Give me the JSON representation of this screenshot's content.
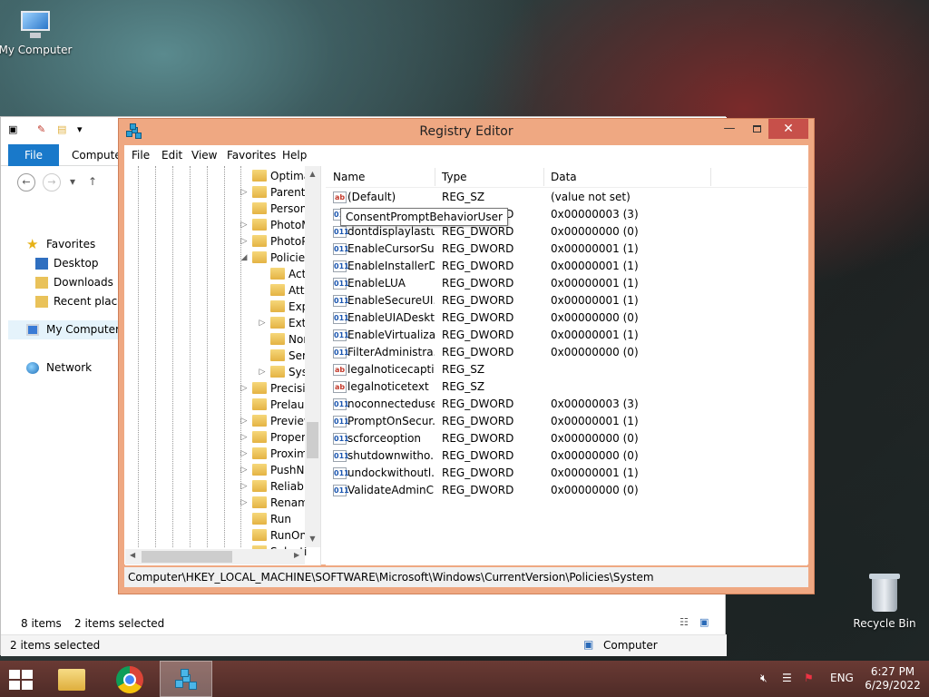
{
  "desktop": {
    "icons": [
      {
        "label": "My Computer",
        "icon": "computer-icon"
      },
      {
        "label": "Recycle Bin",
        "icon": "recycle-bin-icon"
      }
    ]
  },
  "explorer": {
    "tabs": {
      "file": "File",
      "computer": "Computer"
    },
    "nav": {
      "favorites": "Favorites",
      "desktop": "Desktop",
      "downloads": "Downloads",
      "recent_places": "Recent places",
      "my_computer": "My Computer",
      "network": "Network"
    },
    "status": {
      "items": "8 items",
      "selected": "2 items selected",
      "bottom_selected": "2 items selected",
      "location": "Computer"
    }
  },
  "regedit": {
    "title": "Registry Editor",
    "menu": [
      "File",
      "Edit",
      "View",
      "Favorites",
      "Help"
    ],
    "tree": [
      {
        "label": "Optima",
        "indent": 0,
        "expander": ""
      },
      {
        "label": "Parenta",
        "indent": 0,
        "expander": "▷"
      },
      {
        "label": "Persona",
        "indent": 0,
        "expander": ""
      },
      {
        "label": "PhotoM",
        "indent": 0,
        "expander": "▷"
      },
      {
        "label": "PhotoP",
        "indent": 0,
        "expander": "▷"
      },
      {
        "label": "Policies",
        "indent": 0,
        "expander": "◢"
      },
      {
        "label": "Act",
        "indent": 1,
        "expander": ""
      },
      {
        "label": "Atta",
        "indent": 1,
        "expander": ""
      },
      {
        "label": "Exp",
        "indent": 1,
        "expander": ""
      },
      {
        "label": "Ext",
        "indent": 1,
        "expander": "▷"
      },
      {
        "label": "Nor",
        "indent": 1,
        "expander": ""
      },
      {
        "label": "Serv",
        "indent": 1,
        "expander": ""
      },
      {
        "label": "Syst",
        "indent": 1,
        "expander": "▷"
      },
      {
        "label": "Precisio",
        "indent": 0,
        "expander": "▷"
      },
      {
        "label": "Prelaun",
        "indent": 0,
        "expander": ""
      },
      {
        "label": "Preview",
        "indent": 0,
        "expander": "▷"
      },
      {
        "label": "Propert",
        "indent": 0,
        "expander": "▷"
      },
      {
        "label": "Proxim",
        "indent": 0,
        "expander": "▷"
      },
      {
        "label": "PushNo",
        "indent": 0,
        "expander": "▷"
      },
      {
        "label": "Reliabil",
        "indent": 0,
        "expander": "▷"
      },
      {
        "label": "Renam",
        "indent": 0,
        "expander": "▷"
      },
      {
        "label": "Run",
        "indent": 0,
        "expander": ""
      },
      {
        "label": "RunOn",
        "indent": 0,
        "expander": ""
      },
      {
        "label": "Selecti",
        "indent": 0,
        "expander": ""
      }
    ],
    "columns": {
      "name": "Name",
      "type": "Type",
      "data": "Data"
    },
    "values": [
      {
        "name": "(Default)",
        "type": "REG_SZ",
        "data": "(value not set)",
        "kind": "sz"
      },
      {
        "name": "ConsentPr...",
        "type": "REG_DWORD",
        "data": "0x00000003 (3)",
        "kind": "dw"
      },
      {
        "name": "dontdisplaylastu...",
        "type": "REG_DWORD",
        "data": "0x00000000 (0)",
        "kind": "dw"
      },
      {
        "name": "EnableCursorSu...",
        "type": "REG_DWORD",
        "data": "0x00000001 (1)",
        "kind": "dw"
      },
      {
        "name": "EnableInstallerD...",
        "type": "REG_DWORD",
        "data": "0x00000001 (1)",
        "kind": "dw"
      },
      {
        "name": "EnableLUA",
        "type": "REG_DWORD",
        "data": "0x00000001 (1)",
        "kind": "dw"
      },
      {
        "name": "EnableSecureUI...",
        "type": "REG_DWORD",
        "data": "0x00000001 (1)",
        "kind": "dw"
      },
      {
        "name": "EnableUIADeskt...",
        "type": "REG_DWORD",
        "data": "0x00000000 (0)",
        "kind": "dw"
      },
      {
        "name": "EnableVirtualizat...",
        "type": "REG_DWORD",
        "data": "0x00000001 (1)",
        "kind": "dw"
      },
      {
        "name": "FilterAdministra...",
        "type": "REG_DWORD",
        "data": "0x00000000 (0)",
        "kind": "dw"
      },
      {
        "name": "legalnoticecapti...",
        "type": "REG_SZ",
        "data": "",
        "kind": "sz"
      },
      {
        "name": "legalnoticetext",
        "type": "REG_SZ",
        "data": "",
        "kind": "sz"
      },
      {
        "name": "noconnecteduser",
        "type": "REG_DWORD",
        "data": "0x00000003 (3)",
        "kind": "dw"
      },
      {
        "name": "PromptOnSecur...",
        "type": "REG_DWORD",
        "data": "0x00000001 (1)",
        "kind": "dw"
      },
      {
        "name": "scforceoption",
        "type": "REG_DWORD",
        "data": "0x00000000 (0)",
        "kind": "dw"
      },
      {
        "name": "shutdownwitho...",
        "type": "REG_DWORD",
        "data": "0x00000000 (0)",
        "kind": "dw"
      },
      {
        "name": "undockwithoutl...",
        "type": "REG_DWORD",
        "data": "0x00000001 (1)",
        "kind": "dw"
      },
      {
        "name": "ValidateAdminC...",
        "type": "REG_DWORD",
        "data": "0x00000000 (0)",
        "kind": "dw"
      }
    ],
    "tooltip": "ConsentPromptBehaviorUser",
    "statusbar": "Computer\\HKEY_LOCAL_MACHINE\\SOFTWARE\\Microsoft\\Windows\\CurrentVersion\\Policies\\System"
  },
  "taskbar": {
    "language": "ENG",
    "time": "6:27 PM",
    "date": "6/29/2022",
    "apps": [
      "file-explorer-icon",
      "chrome-icon",
      "registry-editor-icon"
    ]
  },
  "colors": {
    "regedit_frame": "#efa882",
    "close_button": "#c7504a",
    "taskbar": "#5a332e",
    "file_tab": "#1979ca"
  }
}
